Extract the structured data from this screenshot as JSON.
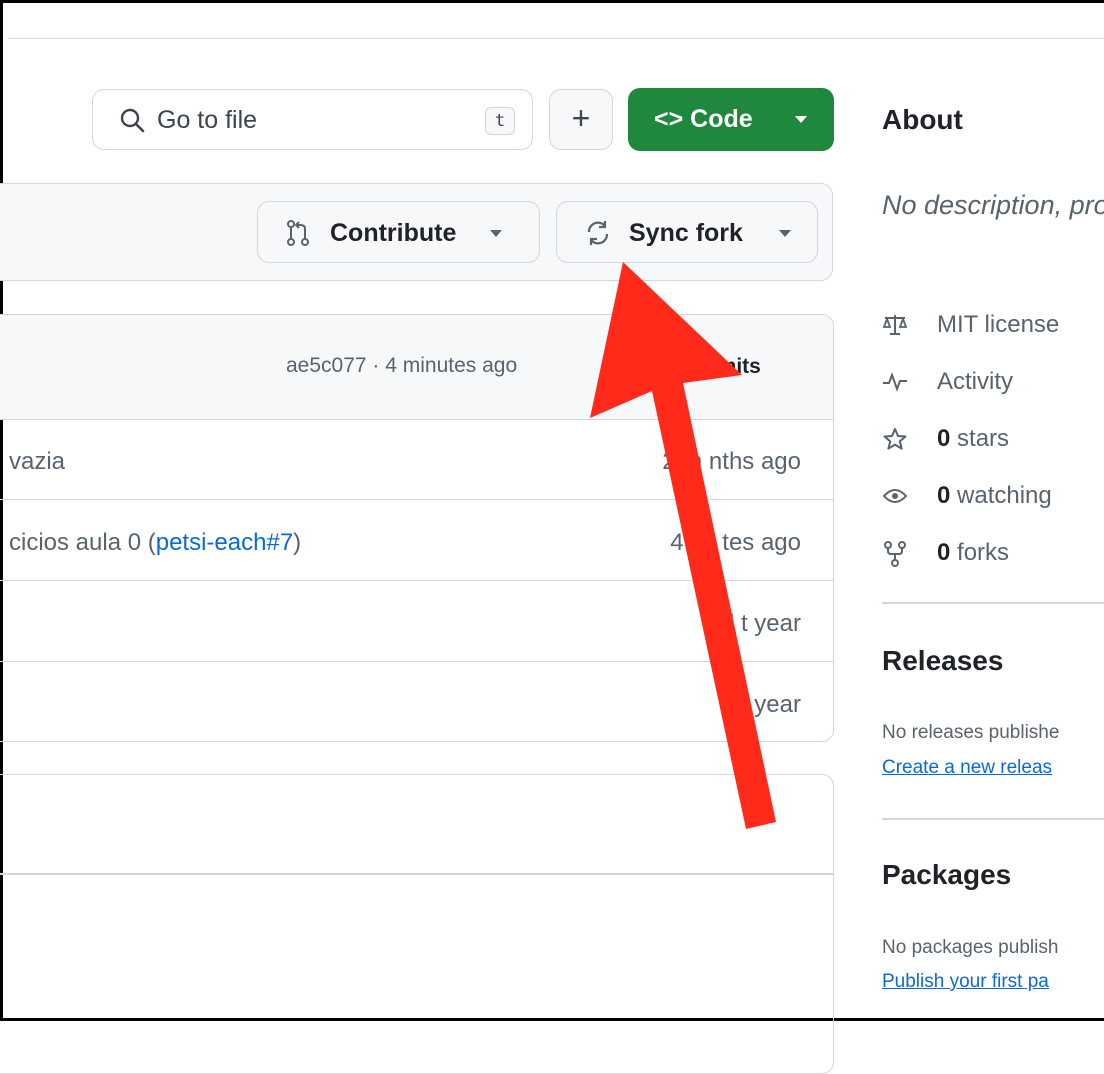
{
  "toolbar": {
    "search_placeholder": "Go to file",
    "search_shortcut": "t",
    "add_label": "+",
    "code_label": "<> Code"
  },
  "fork_banner": {
    "contribute_label": "Contribute",
    "sync_label": "Sync fork"
  },
  "files": {
    "commit_info": "ae5c077 · 4 minutes ago",
    "commits_label": "mmits",
    "rows": [
      {
        "message": "vazia",
        "link": "",
        "time": "2 m nths ago"
      },
      {
        "message": "cicios aula 0 (",
        "link": "petsi-each#7",
        "message_end": ")",
        "time": "4 mi  tes ago"
      },
      {
        "message": "",
        "link": "",
        "time": "l  t year"
      },
      {
        "message": "",
        "link": "",
        "time": "la   year"
      }
    ]
  },
  "sidebar": {
    "about_title": "About",
    "description": "No description, provided.",
    "license": "MIT license",
    "activity": "Activity",
    "stars_count": "0",
    "stars_label": " stars",
    "watching_count": "0",
    "watching_label": " watching",
    "forks_count": "0",
    "forks_label": " forks",
    "releases_title": "Releases",
    "releases_text": "No releases publishe",
    "releases_link": "Create a new releas",
    "packages_title": "Packages",
    "packages_text": "No packages publish",
    "packages_link": "Publish your first pa"
  },
  "colors": {
    "accent_green": "#1f883d",
    "link_blue": "#0969da",
    "arrow_red": "#ff2a1a"
  }
}
